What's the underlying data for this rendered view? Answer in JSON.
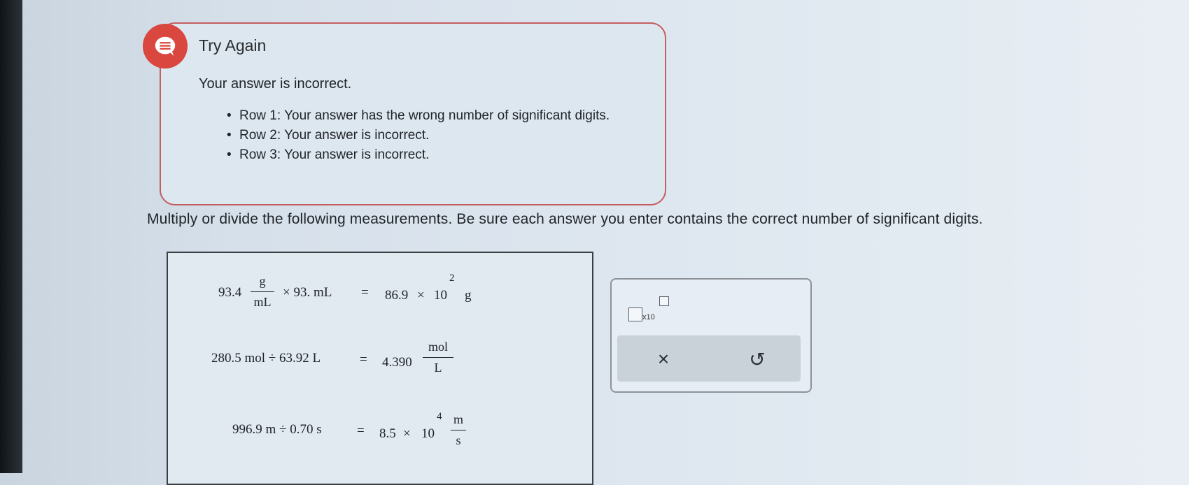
{
  "feedback": {
    "title": "Try Again",
    "verdict": "Your answer is incorrect.",
    "issues": [
      "Row 1: Your answer has the wrong number of significant digits.",
      "Row 2: Your answer is incorrect.",
      "Row 3: Your answer is incorrect."
    ],
    "icon": "chat-bubble-icon",
    "accent": "#d9473f"
  },
  "instructions": "Multiply or divide the following measurements. Be sure each answer you enter contains the correct number of significant digits.",
  "rows": [
    {
      "lhs_value": "93.4",
      "lhs_unit_num": "g",
      "lhs_unit_den": "mL",
      "op_term": "× 93. mL",
      "equals": "=",
      "answer_mantissa": "86.9",
      "answer_times": "×",
      "answer_base": "10",
      "answer_exponent": "2",
      "answer_unit": "g"
    },
    {
      "lhs": "280.5 mol ÷ 63.92 L",
      "equals": "=",
      "answer_value": "4.390",
      "answer_unit_num": "mol",
      "answer_unit_den": "L"
    },
    {
      "lhs": "996.9 m ÷ 0.70 s",
      "equals": "=",
      "answer_mantissa": "8.5",
      "answer_times": "×",
      "answer_base": "10",
      "answer_exponent": "4",
      "answer_unit_num": "m",
      "answer_unit_den": "s"
    }
  ],
  "tools": {
    "sci_notation_label": "x10",
    "clear_icon": "×",
    "undo_icon": "↺"
  }
}
